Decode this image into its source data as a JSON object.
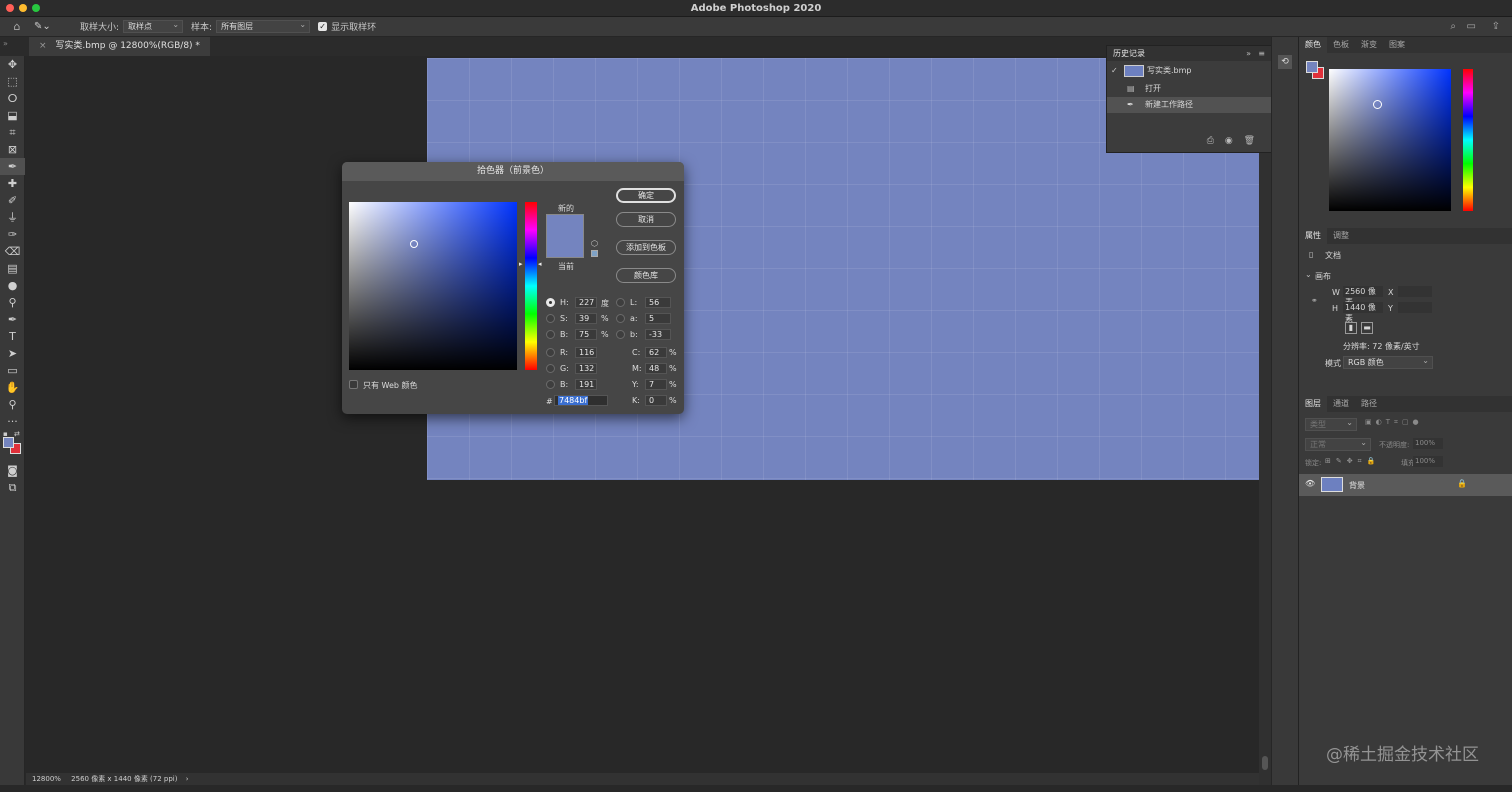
{
  "app": {
    "title": "Adobe Photoshop 2020"
  },
  "options": {
    "sample_size_label": "取样大小:",
    "sample_size_value": "取样点",
    "sample_label": "样本:",
    "sample_value": "所有图层",
    "show_ring_label": "显示取样环"
  },
  "document": {
    "tab_title": "写实类.bmp @ 12800%(RGB/8) *",
    "fill_color": "#7484bf"
  },
  "status": {
    "zoom": "12800%",
    "info": "2560 像素 x 1440 像素 (72 ppi)"
  },
  "history": {
    "title": "历史记录",
    "snapshot": "写实类.bmp",
    "steps": [
      "打开",
      "新建工作路径"
    ]
  },
  "picker": {
    "title": "拾色器（前景色）",
    "new_label": "新的",
    "current_label": "当前",
    "ok": "确定",
    "cancel": "取消",
    "add_swatch": "添加到色板",
    "libraries": "颜色库",
    "web_only": "只有 Web 颜色",
    "h": "227",
    "s": "39",
    "b": "75",
    "l": "56",
    "a": "5",
    "lab_b": "-33",
    "r": "116",
    "g": "132",
    "rgb_b": "191",
    "c": "62",
    "m": "48",
    "y": "7",
    "k": "0",
    "hex": "7484bf",
    "labels": {
      "h": "H:",
      "s": "S:",
      "b": "B:",
      "l": "L:",
      "a": "a:",
      "lab_b": "b:",
      "r": "R:",
      "g": "G:",
      "rgb_b": "B:",
      "c": "C:",
      "m": "M:",
      "y": "Y:",
      "k": "K:",
      "hash": "#"
    },
    "units": {
      "deg": "度",
      "pct": "%"
    },
    "new_color": "#7484bf",
    "current_color": "#7484bf"
  },
  "color_panel": {
    "tabs": [
      "颜色",
      "色板",
      "渐变",
      "图案"
    ],
    "fg": "#7484bf",
    "bg": "#e0303a"
  },
  "properties": {
    "tabs": [
      "属性",
      "调整"
    ],
    "doc_label": "文档",
    "section": "画布",
    "w_label": "W",
    "w": "2560 像素",
    "h_label": "H",
    "h": "1440 像素",
    "x_label": "X",
    "y_label": "Y",
    "resolution": "分辨率: 72 像素/英寸",
    "mode_label": "模式",
    "mode": "RGB 颜色"
  },
  "layers": {
    "tabs": [
      "图层",
      "通道",
      "路径"
    ],
    "kind_placeholder": "类型",
    "blend": "正常",
    "opacity_label": "不透明度:",
    "opacity": "100%",
    "lock_label": "锁定:",
    "fill_label": "填充:",
    "fill": "100%",
    "items": [
      {
        "name": "背景"
      }
    ]
  },
  "watermark": "@稀土掘金技术社区"
}
